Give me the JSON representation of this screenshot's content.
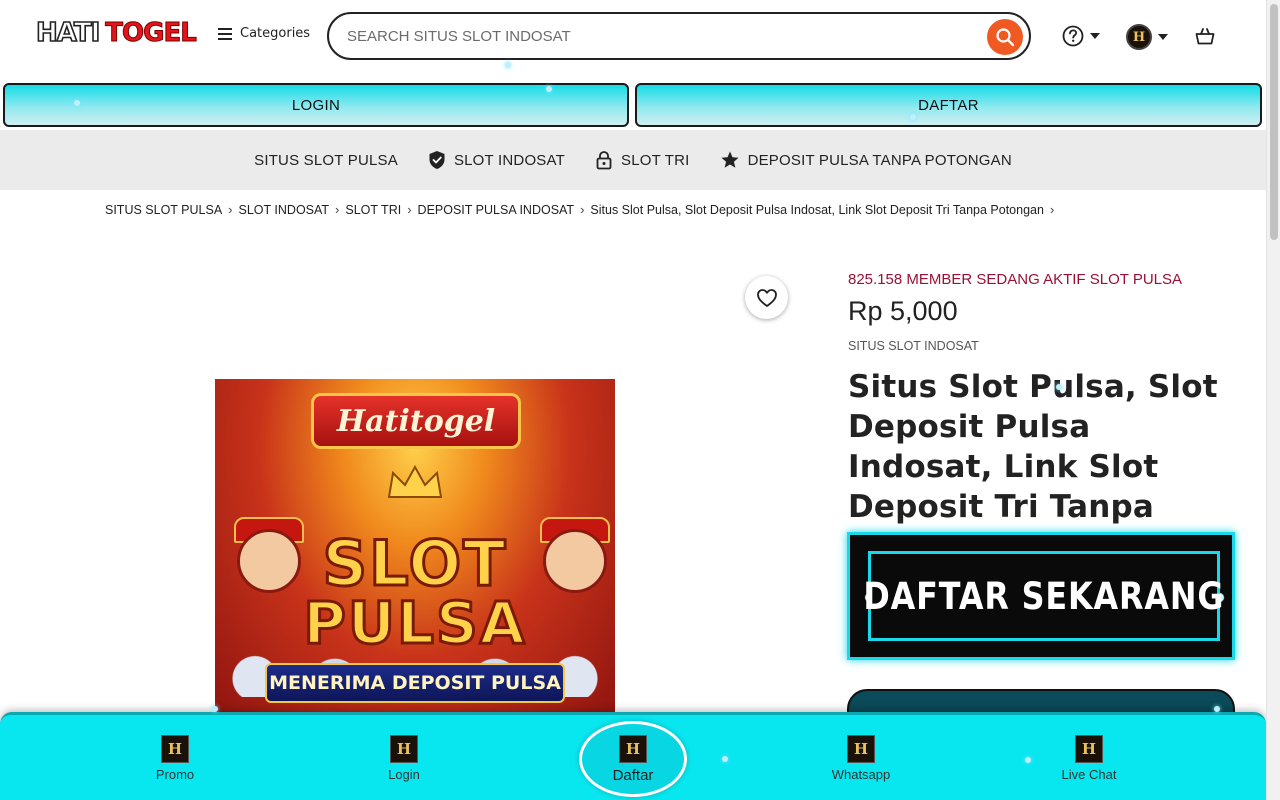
{
  "header": {
    "logo_part1": "HATI",
    "logo_part2": "TOGEL",
    "categories_label": "Categories",
    "search_placeholder": "SEARCH SITUS SLOT INDOSAT",
    "avatar_letter": "H"
  },
  "auth": {
    "login_label": "LOGIN",
    "daftar_label": "DAFTAR"
  },
  "nav": {
    "items": [
      {
        "label": "SITUS SLOT PULSA",
        "icon": "none"
      },
      {
        "label": "SLOT INDOSAT",
        "icon": "shield-check-icon"
      },
      {
        "label": "SLOT TRI",
        "icon": "lock-icon"
      },
      {
        "label": "DEPOSIT PULSA TANPA POTONGAN",
        "icon": "star-icon"
      }
    ]
  },
  "breadcrumb": [
    "SITUS SLOT PULSA",
    "SLOT INDOSAT",
    "SLOT TRI",
    "DEPOSIT PULSA INDOSAT",
    "Situs Slot Pulsa, Slot Deposit Pulsa Indosat, Link Slot Deposit Tri Tanpa Potongan"
  ],
  "product": {
    "active_members": "825.158 MEMBER SEDANG AKTIF SLOT PULSA",
    "price": "Rp 5,000",
    "brand": "SITUS SLOT INDOSAT",
    "title": "Situs Slot Pulsa, Slot Deposit Pulsa Indosat, Link Slot Deposit Tri Tanpa Potongan",
    "cta_label": "DAFTAR SEKARANG",
    "image": {
      "banner": "Hatitogel",
      "line1": "SLOT",
      "line2": "PULSA",
      "strip": "MENERIMA DEPOSIT PULSA"
    }
  },
  "bottom_nav": {
    "items": [
      {
        "label": "Promo"
      },
      {
        "label": "Login"
      },
      {
        "label": "Daftar"
      },
      {
        "label": "Whatsapp"
      },
      {
        "label": "Live Chat"
      }
    ],
    "icon_letter": "H"
  },
  "colors": {
    "accent": "#08e6ef",
    "search_button": "#f05a22",
    "member_text": "#9c1036"
  }
}
